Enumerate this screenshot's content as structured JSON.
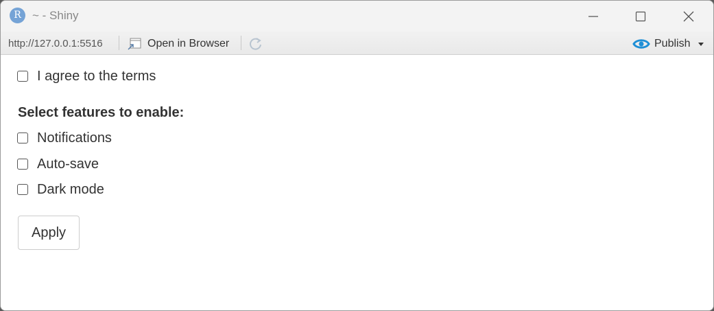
{
  "window": {
    "app_icon_letter": "R",
    "title": "~ - Shiny"
  },
  "toolbar": {
    "url": "http://127.0.0.1:5516",
    "open_in_browser_label": "Open in Browser",
    "publish_label": "Publish"
  },
  "form": {
    "agree_label": "I agree to the terms",
    "features_heading": "Select features to enable:",
    "features": [
      {
        "label": "Notifications",
        "checked": false
      },
      {
        "label": "Auto-save",
        "checked": false
      },
      {
        "label": "Dark mode",
        "checked": false
      }
    ],
    "agree_checked": false,
    "apply_label": "Apply"
  },
  "colors": {
    "accent_publish": "#1f8fd6",
    "app_icon": "#75a3d6"
  }
}
